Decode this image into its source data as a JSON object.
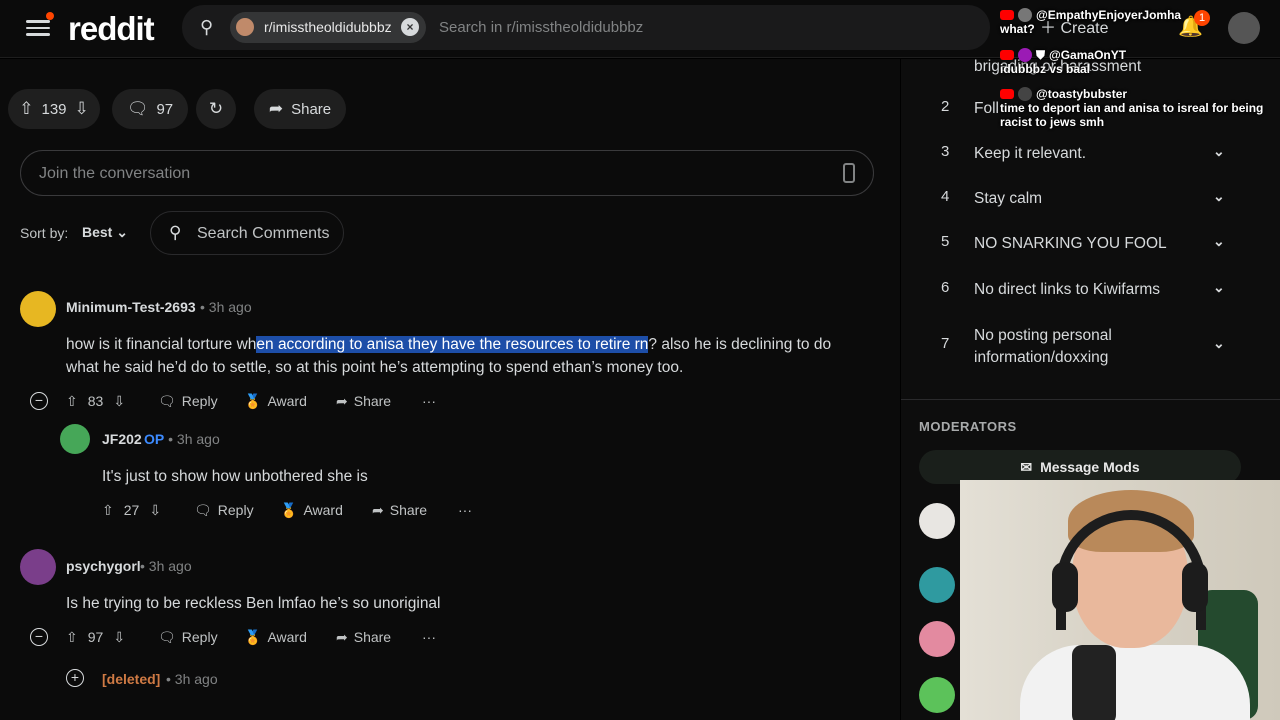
{
  "header": {
    "logo": "reddit",
    "subreddit_chip": "r/imisstheoldidubbbz",
    "search_placeholder": "Search in r/imisstheoldidubbbz",
    "create_label": "Create",
    "notification_count": "1"
  },
  "post_actions": {
    "vote_count": "139",
    "comment_count": "97",
    "share_label": "Share"
  },
  "composer": {
    "placeholder": "Join the conversation"
  },
  "sort": {
    "label": "Sort by:",
    "value": "Best",
    "search_comments": "Search Comments"
  },
  "comments": [
    {
      "author": "Minimum-Test-2693",
      "time": "3h ago",
      "body_pre": "how is it financial torture wh",
      "body_highlight": "en according to anisa they have the resources to retire rn",
      "body_post": "? also he is declining to do what he said he’d do to settle, so at this point he’s attempting to spend ethan’s money too.",
      "votes": "83",
      "reply": "Reply",
      "award": "Award",
      "share": "Share"
    },
    {
      "author": "JF202",
      "flair": "OP",
      "time": "3h ago",
      "body": "It's just to show how unbothered she is",
      "votes": "27",
      "reply": "Reply",
      "award": "Award",
      "share": "Share"
    },
    {
      "author": "psychygorl",
      "time": "3h ago",
      "body": "Is he trying to be reckless Ben lmfao he’s so unoriginal",
      "votes": "97",
      "reply": "Reply",
      "award": "Award",
      "share": "Share"
    },
    {
      "author": "[deleted]",
      "time": "3h ago"
    }
  ],
  "sidebar": {
    "partial_rule": "brigading or harassment",
    "rules": [
      {
        "num": "2",
        "label": "Foll"
      },
      {
        "num": "3",
        "label": "Keep it relevant."
      },
      {
        "num": "4",
        "label": "Stay calm"
      },
      {
        "num": "5",
        "label": "NO SNARKING YOU FOOL"
      },
      {
        "num": "6",
        "label": "No direct links to Kiwifarms"
      },
      {
        "num": "7",
        "label": "No posting personal information/doxxing"
      }
    ],
    "moderators_header": "MODERATORS",
    "message_mods": "Message Mods"
  },
  "chat_overlay": [
    {
      "user": "@EmpathyEnjoyerJomha",
      "text": "what?"
    },
    {
      "user": "@GamaOnYT",
      "text": "idubbbz vs baal"
    },
    {
      "user": "@toastybubster",
      "text": "time to deport ian and anisa to isreal for being racist to jews smh"
    }
  ],
  "colors": {
    "accent": "#ff4500",
    "highlight": "#1d4ea8",
    "op_flair": "#3d8bff",
    "deleted": "#cf7a44"
  }
}
